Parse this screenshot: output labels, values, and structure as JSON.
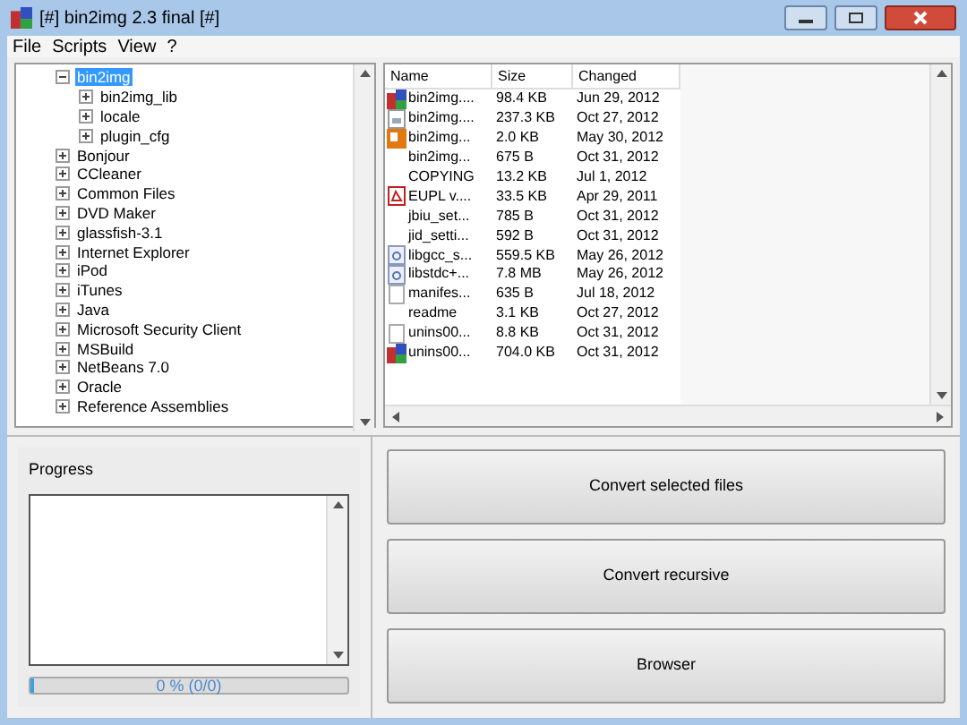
{
  "window": {
    "title": "[#] bin2img 2.3 final [#]"
  },
  "menu": [
    "File",
    "Scripts",
    "View",
    "?"
  ],
  "tree": [
    {
      "label": "bin2img",
      "selected": true,
      "expanded": true,
      "children": [
        {
          "label": "bin2img_lib",
          "selected": false,
          "expanded": false
        },
        {
          "label": "locale",
          "selected": false,
          "expanded": false
        },
        {
          "label": "plugin_cfg",
          "selected": false,
          "expanded": false
        }
      ]
    },
    {
      "label": "Bonjour",
      "selected": false,
      "expanded": false
    },
    {
      "label": "CCleaner",
      "selected": false,
      "expanded": false
    },
    {
      "label": "Common Files",
      "selected": false,
      "expanded": false
    },
    {
      "label": "DVD Maker",
      "selected": false,
      "expanded": false
    },
    {
      "label": "glassfish-3.1",
      "selected": false,
      "expanded": false
    },
    {
      "label": "Internet Explorer",
      "selected": false,
      "expanded": false
    },
    {
      "label": "iPod",
      "selected": false,
      "expanded": false
    },
    {
      "label": "iTunes",
      "selected": false,
      "expanded": false
    },
    {
      "label": "Java",
      "selected": false,
      "expanded": false
    },
    {
      "label": "Microsoft Security Client",
      "selected": false,
      "expanded": false
    },
    {
      "label": "MSBuild",
      "selected": false,
      "expanded": false
    },
    {
      "label": "NetBeans 7.0",
      "selected": false,
      "expanded": false
    },
    {
      "label": "Oracle",
      "selected": false,
      "expanded": false
    },
    {
      "label": "Reference Assemblies",
      "selected": false,
      "expanded": false
    }
  ],
  "files": {
    "columns": [
      "Name",
      "Size",
      "Changed"
    ],
    "rows": [
      {
        "kind": "app",
        "name": "bin2img....",
        "size": "98.4 KB",
        "changed": "Jun 29, 2012"
      },
      {
        "kind": "image",
        "name": "bin2img....",
        "size": "237.3 KB",
        "changed": "Oct 27, 2012"
      },
      {
        "kind": "script",
        "name": "bin2img...",
        "size": "2.0 KB",
        "changed": "May 30, 2012"
      },
      {
        "kind": "none",
        "name": "bin2img...",
        "size": "675 B",
        "changed": "Oct 31, 2012"
      },
      {
        "kind": "none",
        "name": "COPYING",
        "size": "13.2 KB",
        "changed": "Jul 1, 2012"
      },
      {
        "kind": "pdf",
        "name": "EUPL v....",
        "size": "33.5 KB",
        "changed": "Apr 29, 2011"
      },
      {
        "kind": "none",
        "name": "jbiu_set...",
        "size": "785 B",
        "changed": "Oct 31, 2012"
      },
      {
        "kind": "none",
        "name": "jid_setti...",
        "size": "592 B",
        "changed": "Oct 31, 2012"
      },
      {
        "kind": "library",
        "name": "libgcc_s...",
        "size": "559.5 KB",
        "changed": "May 26, 2012"
      },
      {
        "kind": "library",
        "name": "libstdc+...",
        "size": "7.8 MB",
        "changed": "May 26, 2012"
      },
      {
        "kind": "document",
        "name": "manifes...",
        "size": "635 B",
        "changed": "Jul 18, 2012"
      },
      {
        "kind": "none",
        "name": "readme",
        "size": "3.1 KB",
        "changed": "Oct 27, 2012"
      },
      {
        "kind": "document",
        "name": "unins00...",
        "size": "8.8 KB",
        "changed": "Oct 31, 2012"
      },
      {
        "kind": "app",
        "name": "unins00...",
        "size": "704.0 KB",
        "changed": "Oct 31, 2012"
      }
    ]
  },
  "progress": {
    "title": "Progress",
    "level": 0,
    "reading": "0 % (0/0)"
  },
  "buttons": [
    "Convert selected files",
    "Convert recursive",
    "Browser"
  ]
}
